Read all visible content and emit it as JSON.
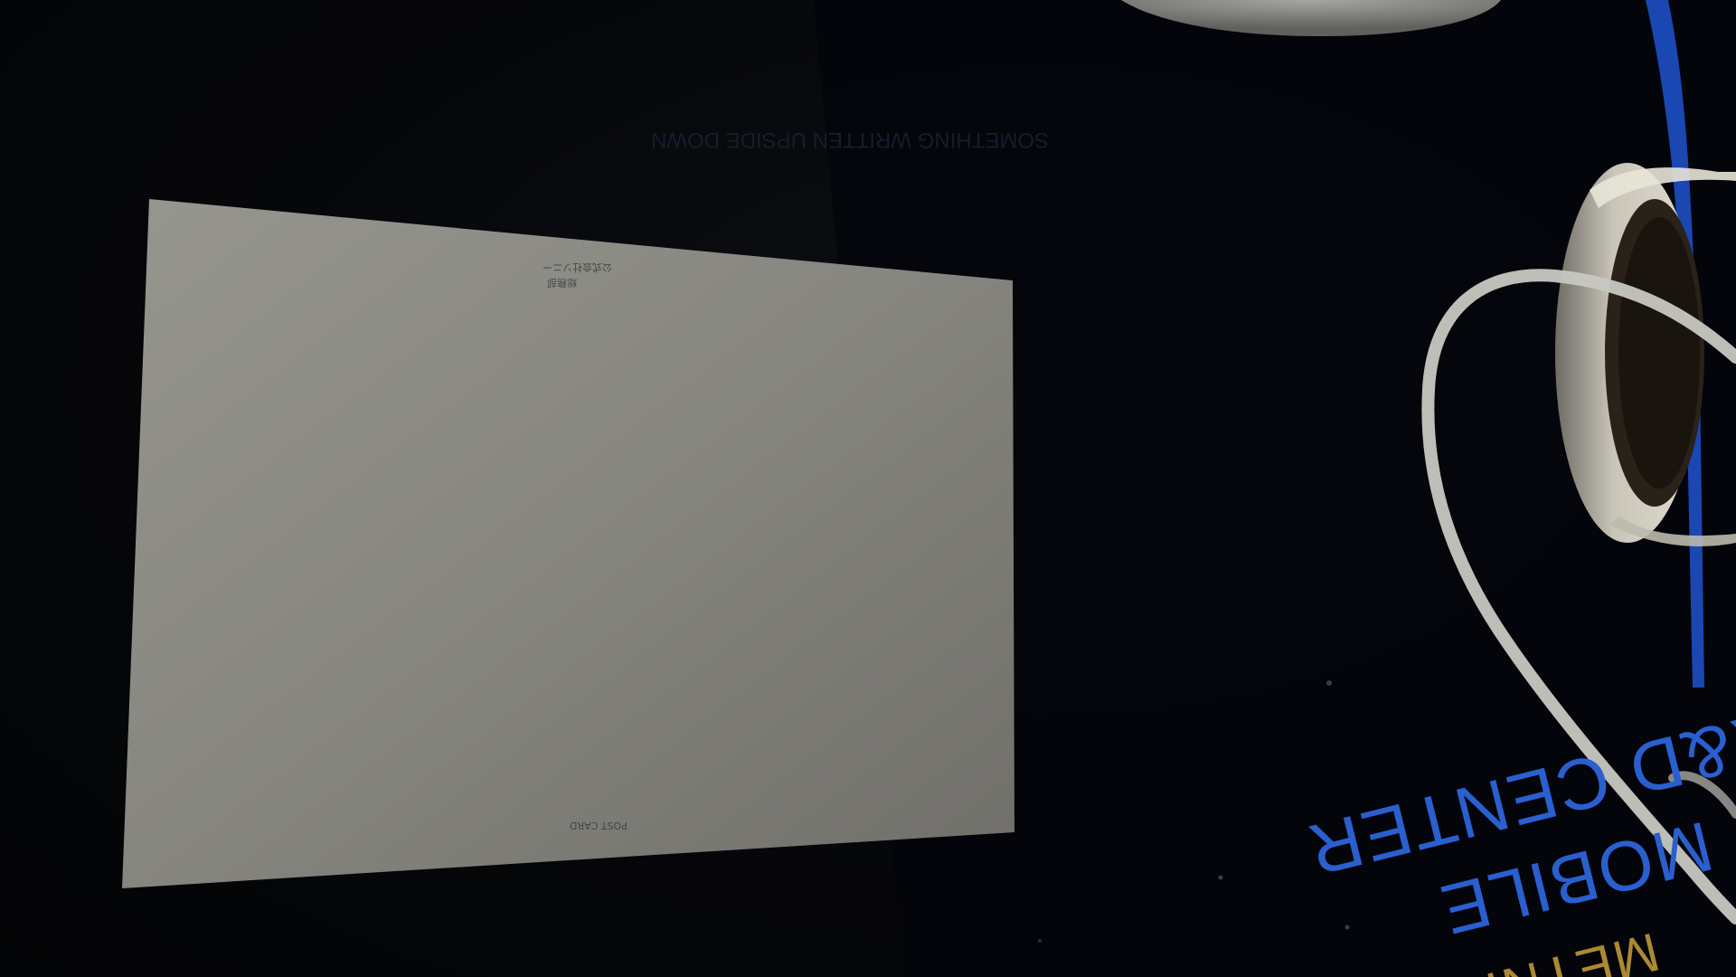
{
  "scene": {
    "card_top_line1": "公式会社ソニー",
    "card_top_line2": "総務部",
    "card_bottom_text": "POST CARD",
    "mat_text_line1": "R&D CENTER",
    "mat_text_line2": "MOBILE",
    "mat_text_line3": "METNI",
    "mat_faint_line1": "SOMETHING WRITTEN UPSIDE DOWN",
    "mat_faint_line2": ""
  },
  "colors": {
    "background": "#050608",
    "card": "#8a8a86",
    "mat_accent_blue": "#2a5fd0",
    "mat_accent_gold": "#caa13a",
    "tape": "#d8d4c8",
    "cable": "#c8c8c2"
  }
}
